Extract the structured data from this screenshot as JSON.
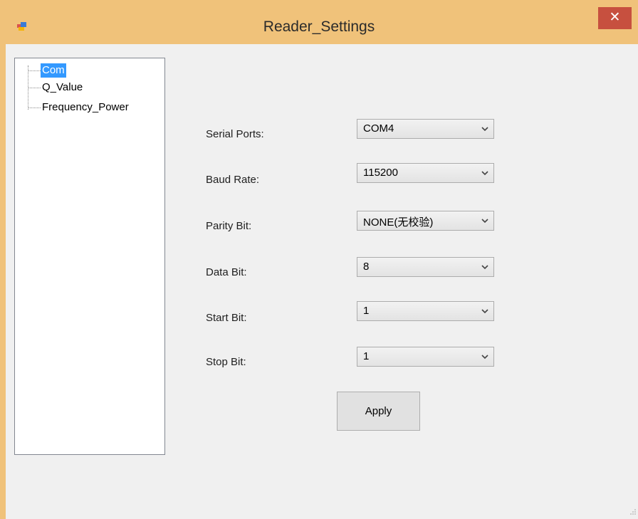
{
  "window": {
    "title": "Reader_Settings",
    "close_glyph": "✕",
    "accent_color": "#f0c27a",
    "close_color": "#c7503f"
  },
  "tree": {
    "items": [
      {
        "label": "Com",
        "selected": true
      },
      {
        "label": "Q_Value",
        "selected": false
      },
      {
        "label": "Frequency_Power",
        "selected": false
      }
    ]
  },
  "form": {
    "fields": [
      {
        "label": "Serial Ports:",
        "value": "COM4"
      },
      {
        "label": "Baud Rate:",
        "value": "115200"
      },
      {
        "label": "Parity Bit:",
        "value": "NONE(无校验)"
      },
      {
        "label": "Data Bit:",
        "value": "8"
      },
      {
        "label": "Start Bit:",
        "value": "1"
      },
      {
        "label": "Stop Bit:",
        "value": "1"
      }
    ],
    "apply_label": "Apply"
  },
  "icons": {
    "app": "window-app-icon",
    "close": "close-icon",
    "dropdown": "chevron-down-icon",
    "resize": "resize-grip-icon"
  }
}
